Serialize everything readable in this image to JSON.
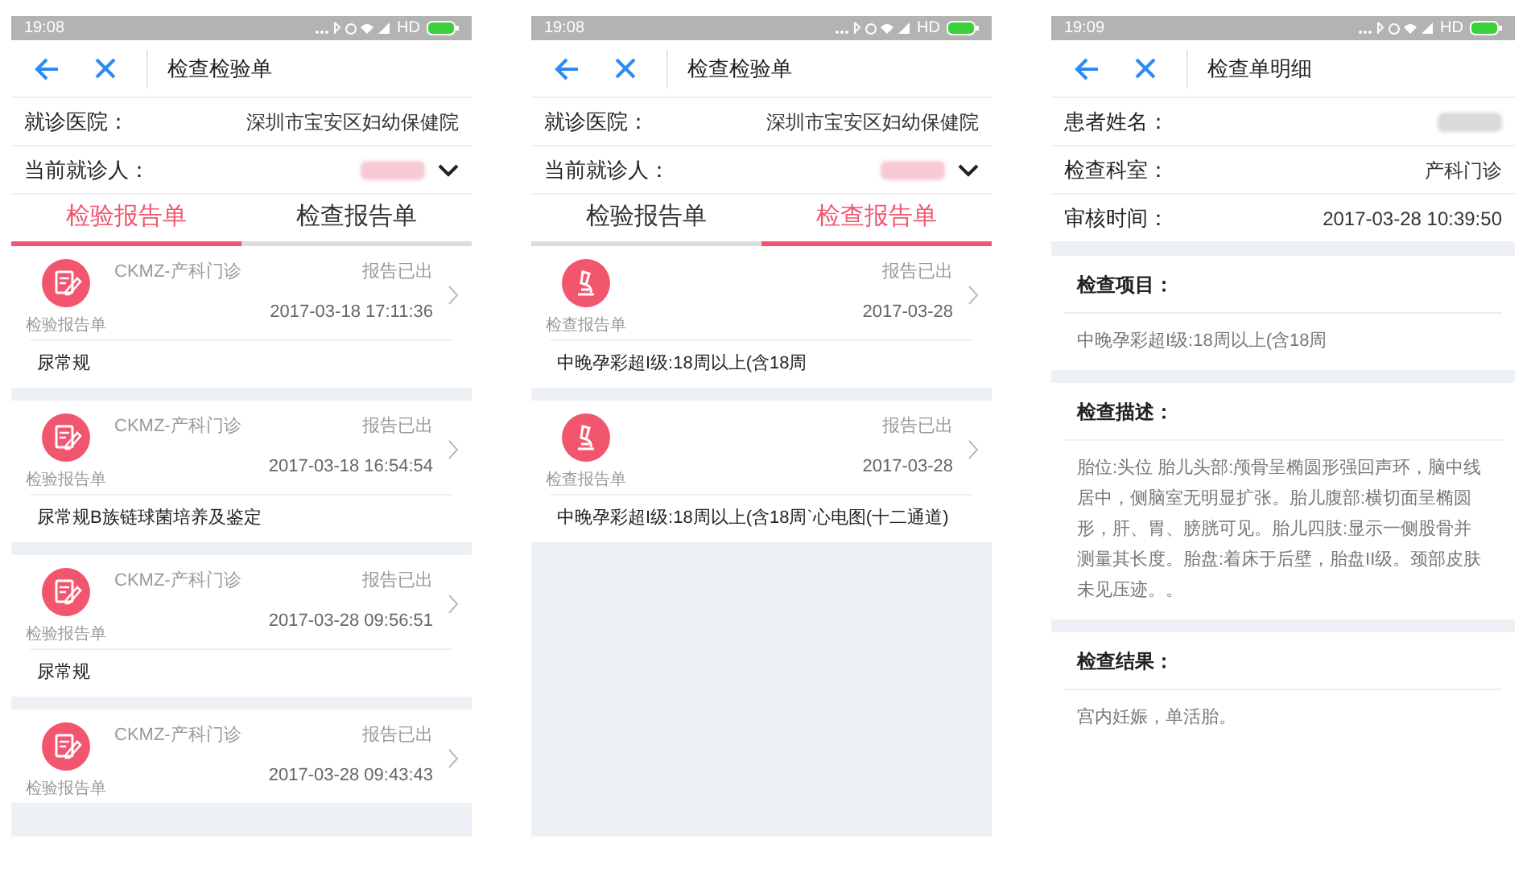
{
  "screens": [
    {
      "kind": "list",
      "status_bar": {
        "time": "19:08",
        "network": "HD"
      },
      "header": {
        "title": "检查检验单"
      },
      "info_rows": [
        {
          "kind": "text",
          "label": "就诊医院：",
          "value": "深圳市宝安区妇幼保健院"
        },
        {
          "kind": "select",
          "label": "当前就诊人："
        }
      ],
      "tabs": [
        {
          "label": "检验报告单",
          "selected": true
        },
        {
          "label": "检查报告单",
          "selected": false
        }
      ],
      "reports": [
        {
          "kind": "lab",
          "type_label": "检验报告单",
          "dept": "CKMZ-产科门诊",
          "status": "报告已出",
          "time": "2017-03-18 17:11:36",
          "title": "尿常规"
        },
        {
          "kind": "lab",
          "type_label": "检验报告单",
          "dept": "CKMZ-产科门诊",
          "status": "报告已出",
          "time": "2017-03-18 16:54:54",
          "title": "尿常规B族链球菌培养及鉴定"
        },
        {
          "kind": "lab",
          "type_label": "检验报告单",
          "dept": "CKMZ-产科门诊",
          "status": "报告已出",
          "time": "2017-03-28 09:56:51",
          "title": "尿常规"
        },
        {
          "kind": "lab",
          "type_label": "检验报告单",
          "dept": "CKMZ-产科门诊",
          "status": "报告已出",
          "time": "2017-03-28 09:43:43"
        }
      ]
    },
    {
      "kind": "list",
      "status_bar": {
        "time": "19:08",
        "network": "HD"
      },
      "header": {
        "title": "检查检验单"
      },
      "info_rows": [
        {
          "kind": "text",
          "label": "就诊医院：",
          "value": "深圳市宝安区妇幼保健院"
        },
        {
          "kind": "select",
          "label": "当前就诊人："
        }
      ],
      "tabs": [
        {
          "label": "检验报告单",
          "selected": false
        },
        {
          "label": "检查报告单",
          "selected": true
        }
      ],
      "reports": [
        {
          "kind": "exam",
          "type_label": "检查报告单",
          "status": "报告已出",
          "time": "2017-03-28",
          "title": "中晚孕彩超I级:18周以上(含18周"
        },
        {
          "kind": "exam",
          "type_label": "检查报告单",
          "status": "报告已出",
          "time": "2017-03-28",
          "title": "中晚孕彩超I级:18周以上(含18周`心电图(十二通道)"
        }
      ]
    },
    {
      "kind": "detail",
      "status_bar": {
        "time": "19:09",
        "network": "HD"
      },
      "header": {
        "title": "检查单明细"
      },
      "info_rows": [
        {
          "kind": "hidden",
          "label": "患者姓名："
        },
        {
          "kind": "text",
          "label": "检查科室：",
          "value": "产科门诊"
        },
        {
          "kind": "text",
          "label": "审核时间：",
          "value": "2017-03-28 10:39:50"
        }
      ],
      "sections": [
        {
          "heading": "检查项目：",
          "body": "中晚孕彩超I级:18周以上(含18周"
        },
        {
          "heading": "检查描述：",
          "body": "胎位:头位 胎儿头部:颅骨呈椭圆形强回声环，脑中线居中，侧脑室无明显扩张。胎儿腹部:横切面呈椭圆形，肝、胃、膀胱可见。胎儿四肢:显示一侧股骨并测量其长度。胎盘:着床于后壁，胎盘II级。颈部皮肤未见压迹。。"
        },
        {
          "heading": "检查结果：",
          "body": "宫内妊娠，单活胎。"
        }
      ]
    }
  ]
}
